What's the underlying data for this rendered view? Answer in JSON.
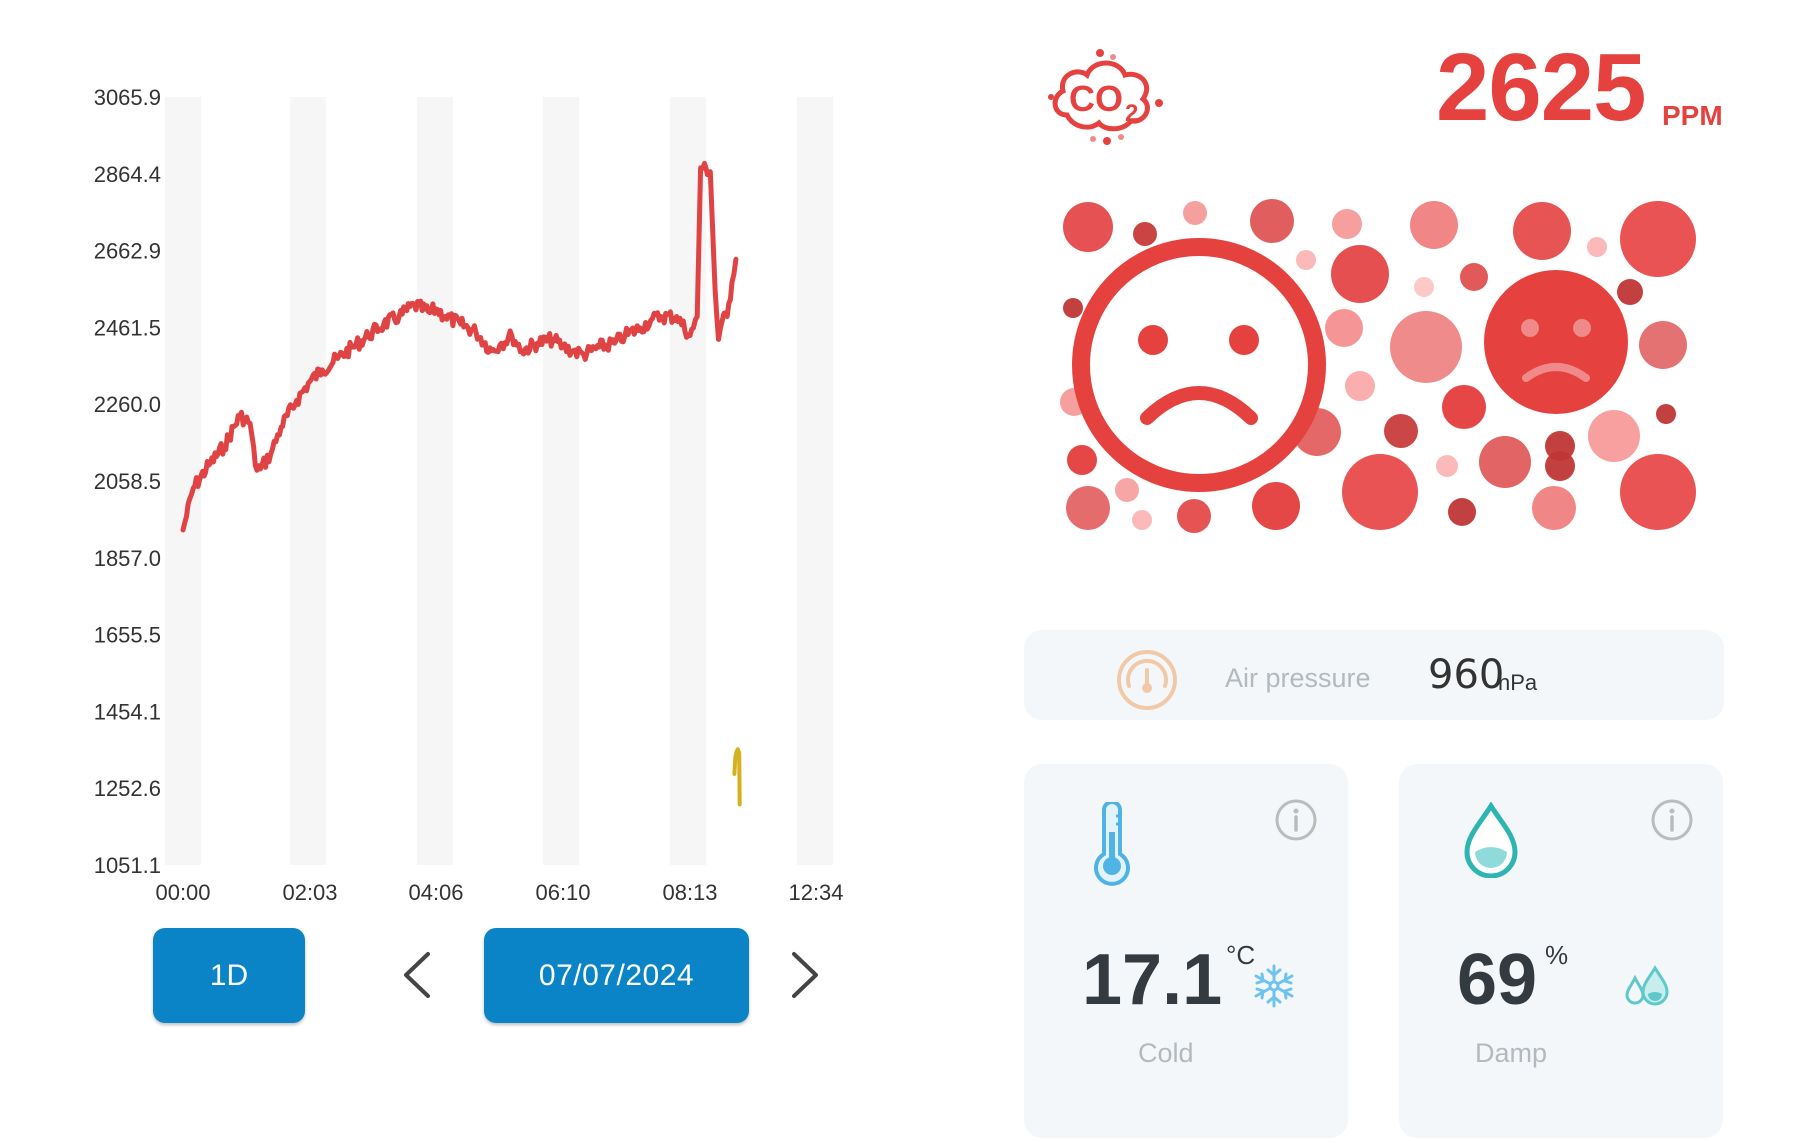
{
  "chart_data": {
    "type": "line",
    "y_ticks": [
      "3065.9",
      "2864.4",
      "2662.9",
      "2461.5",
      "2260.0",
      "2058.5",
      "1857.0",
      "1655.5",
      "1454.1",
      "1252.6",
      "1051.1"
    ],
    "x_ticks": [
      "00:00",
      "02:03",
      "04:06",
      "06:10",
      "08:13",
      "12:34"
    ],
    "ylim": [
      1051.1,
      3065.9
    ],
    "series": [
      {
        "color": "#e04343",
        "x": [
          "00:00",
          "00:10",
          "00:25",
          "00:40",
          "00:55",
          "01:05",
          "01:10",
          "01:15",
          "01:25",
          "01:35",
          "01:50",
          "02:03",
          "02:15",
          "02:30",
          "02:45",
          "03:00",
          "03:15",
          "03:30",
          "03:45",
          "04:00",
          "04:06",
          "04:15",
          "04:30",
          "04:45",
          "05:00",
          "05:10",
          "05:20",
          "05:30",
          "05:45",
          "06:00",
          "06:10",
          "06:20",
          "06:30",
          "06:45",
          "07:00",
          "07:10",
          "07:25",
          "07:35",
          "07:45",
          "08:00",
          "08:13",
          "08:20",
          "08:28",
          "08:35",
          "08:40",
          "08:55",
          "09:05",
          "09:12",
          "09:20",
          "09:30",
          "09:40",
          "09:48"
        ],
        "y": [
          1930,
          2040,
          2100,
          2150,
          2230,
          2210,
          2100,
          2090,
          2130,
          2200,
          2270,
          2320,
          2350,
          2380,
          2410,
          2440,
          2470,
          2490,
          2520,
          2500,
          2510,
          2490,
          2470,
          2450,
          2400,
          2420,
          2440,
          2400,
          2420,
          2430,
          2410,
          2400,
          2390,
          2410,
          2420,
          2440,
          2460,
          2480,
          2490,
          2490,
          2440,
          2460,
          2490,
          2880,
          2880,
          2870,
          2560,
          2430,
          2480,
          2490,
          2580,
          2640
        ]
      },
      {
        "color": "#d4b11e",
        "x": [
          "09:45",
          "09:47",
          "09:50",
          "09:52",
          "09:55",
          "09:56"
        ],
        "y": [
          1290,
          1335,
          1350,
          1355,
          1345,
          1210
        ]
      }
    ]
  },
  "controls": {
    "range_label": "1D",
    "date_label": "07/07/2024"
  },
  "co2": {
    "icon": "co2-cloud-icon",
    "value": "2625",
    "unit": "PPM"
  },
  "pressure": {
    "label": "Air pressure",
    "value": "960",
    "unit": "hPa"
  },
  "temperature": {
    "value": "17.1",
    "unit": "°C",
    "state": "Cold"
  },
  "humidity": {
    "value": "69",
    "unit": "%",
    "state": "Damp"
  },
  "colors": {
    "accent_red": "#e5413f",
    "button_blue": "#0a84c6",
    "temp_blue": "#5bb8e8",
    "humidity_teal": "#3ab8b8"
  }
}
